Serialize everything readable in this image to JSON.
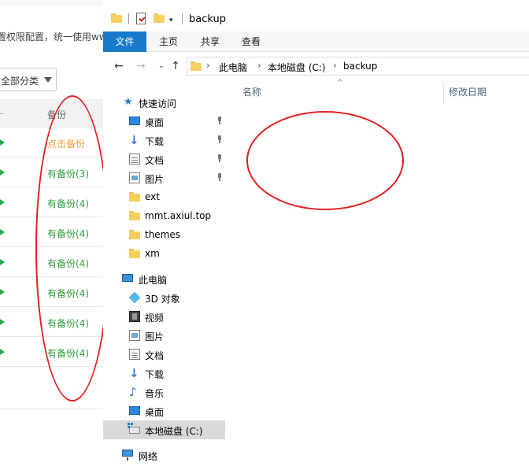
{
  "left_panel": {
    "notice_text": "置权限配置，统一使用www",
    "category_select": {
      "value": "全部分类"
    },
    "table_header": {
      "backup_col": "备份"
    },
    "rows": [
      {
        "status": "点击备份",
        "color": "orange"
      },
      {
        "status": "有备份(3)",
        "color": "green"
      },
      {
        "status": "有备份(4)",
        "color": "green"
      },
      {
        "status": "有备份(4)",
        "color": "green"
      },
      {
        "status": "有备份(4)",
        "color": "green"
      },
      {
        "status": "有备份(4)",
        "color": "green"
      },
      {
        "status": "有备份(4)",
        "color": "green"
      },
      {
        "status": "有备份(4)",
        "color": "green"
      }
    ]
  },
  "explorer": {
    "title": "backup",
    "ribbon_tabs": [
      "文件",
      "主页",
      "共享",
      "查看"
    ],
    "active_tab": "文件",
    "address": [
      "此电脑",
      "本地磁盘 (C:)",
      "backup"
    ],
    "nav": {
      "quick_access": "快速访问",
      "quick_items": [
        "桌面",
        "下载",
        "文档",
        "图片",
        "ext",
        "mmt.axiul.top",
        "themes",
        "xm"
      ],
      "this_pc": "此电脑",
      "pc_items": [
        "3D 对象",
        "视频",
        "图片",
        "文档",
        "下载",
        "音乐",
        "桌面",
        "本地磁盘 (C:)"
      ],
      "network": "网络",
      "selected": "本地磁盘 (C:)"
    },
    "columns": {
      "name": "名称",
      "date_modified": "修改日期"
    }
  },
  "colors": {
    "ribbon_active": "#1979ca",
    "annotation_red": "#e02020",
    "status_green": "#2e9d3a",
    "status_orange": "#f0a33b"
  }
}
